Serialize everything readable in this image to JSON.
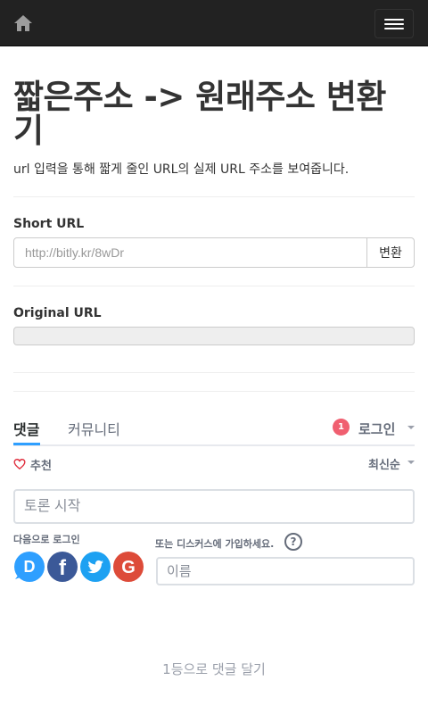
{
  "navbar": {
    "home_icon": "home-icon",
    "menu_icon": "hamburger-menu-icon"
  },
  "page": {
    "title": "짧은주소 -> 원래주소 변환기",
    "description": "url 입력을 통해 짧게 줄인 URL의 실제 URL 주소를 보여줍니다."
  },
  "short_url": {
    "label": "Short URL",
    "placeholder": "http://bitly.kr/8wDr",
    "value": "",
    "button_label": "변환"
  },
  "original_url": {
    "label": "Original URL",
    "value": ""
  },
  "comments": {
    "tabs": [
      {
        "label": "댓글",
        "active": true
      },
      {
        "label": "커뮤니티",
        "active": false
      }
    ],
    "notification_count": "1",
    "login_label": "로그인",
    "recommend_label": "추천",
    "sort_label": "최신순",
    "discussion_placeholder": "토론 시작",
    "login_with_label": "다음으로 로그인",
    "signup_label": "또는 디스커스에 가입하세요.",
    "help_glyph": "?",
    "social_logins": [
      {
        "name": "disqus",
        "icon": "disqus-icon",
        "color": "#2e9fff",
        "glyph": "D"
      },
      {
        "name": "facebook",
        "icon": "facebook-icon",
        "color": "#3b5998",
        "glyph": "f"
      },
      {
        "name": "twitter",
        "icon": "twitter-icon",
        "color": "#1da1f2"
      },
      {
        "name": "google",
        "icon": "google-icon",
        "color": "#dd4b39",
        "glyph": "G"
      }
    ],
    "name_placeholder": "이름",
    "first_comment_label": "1등으로 댓글 달기"
  },
  "colors": {
    "navbar_bg": "#222222",
    "accent_blue": "#2e9fff",
    "badge_red": "#f05f70",
    "heart_red": "#e0303f"
  }
}
